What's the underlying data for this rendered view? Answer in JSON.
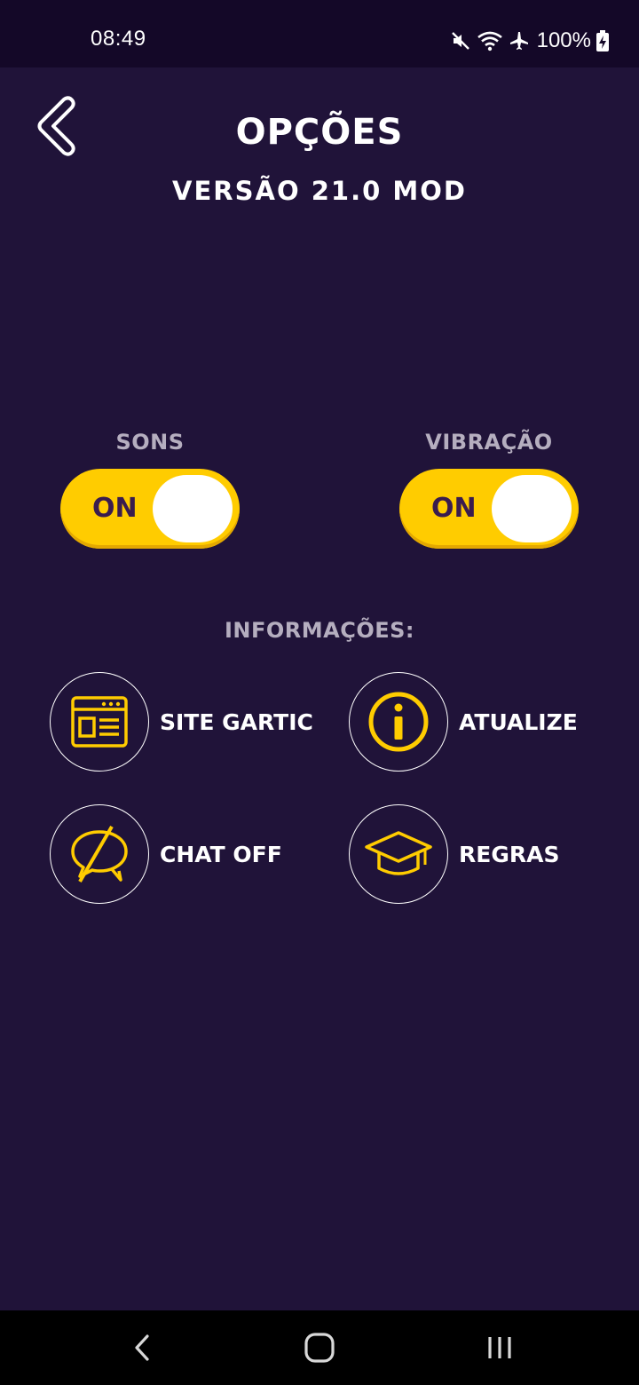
{
  "status_bar": {
    "time": "08:49",
    "battery": "100%",
    "icons": [
      "mute-icon",
      "wifi-icon",
      "airplane-icon",
      "battery-charging-icon"
    ]
  },
  "header": {
    "title": "OPÇÕES",
    "version": "VERSÃO 21.0 MOD"
  },
  "toggles": [
    {
      "label": "SONS",
      "state": "ON"
    },
    {
      "label": "VIBRAÇÃO",
      "state": "ON"
    }
  ],
  "info": {
    "title": "INFORMAÇÕES:",
    "items": [
      {
        "label": "SITE GARTIC",
        "icon": "website-icon"
      },
      {
        "label": "ATUALIZE",
        "icon": "info-icon"
      },
      {
        "label": "CHAT OFF",
        "icon": "chat-off-icon"
      },
      {
        "label": "REGRAS",
        "icon": "graduation-cap-icon"
      }
    ]
  },
  "colors": {
    "background": "#201339",
    "status_bar": "#140828",
    "accent": "#ffcc00",
    "toggle_text": "#3a1c4e",
    "muted_text": "#b5aebf"
  }
}
